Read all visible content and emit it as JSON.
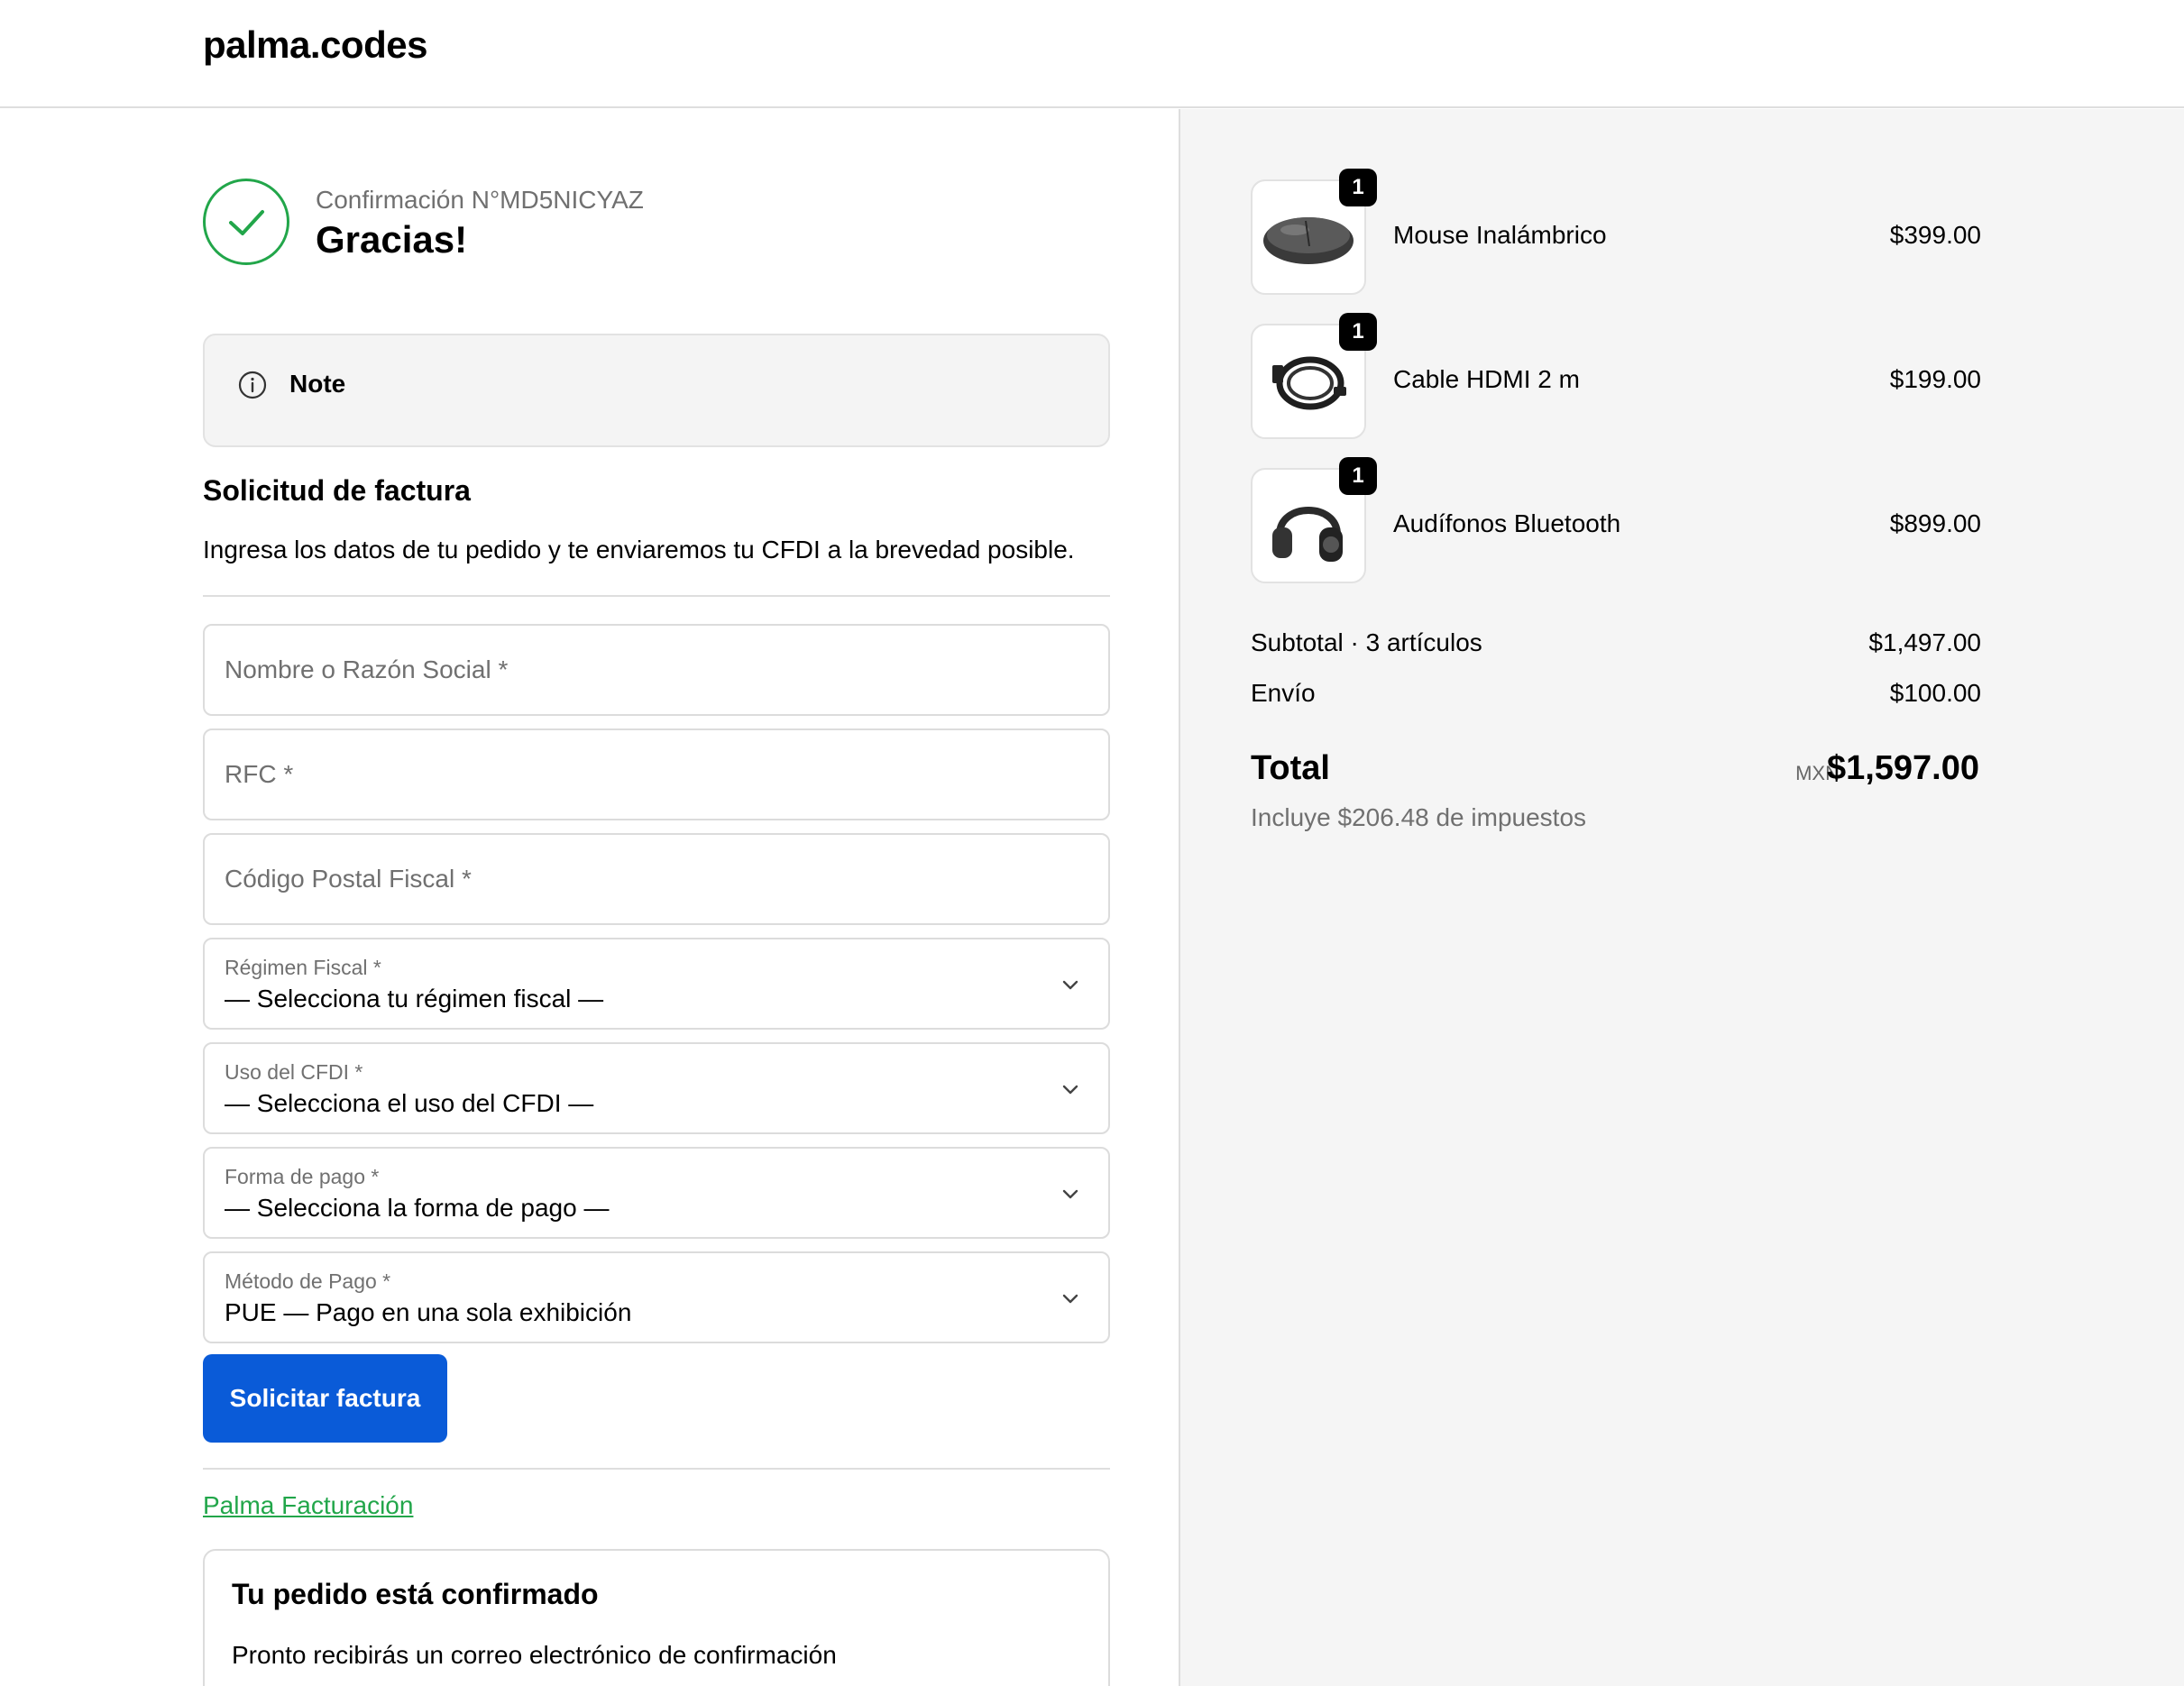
{
  "header": {
    "logo": "palma.codes"
  },
  "confirmation": {
    "number": "Confirmación N°MD5NICYAZ",
    "thanks": "Gracias!"
  },
  "note": {
    "icon": "info-icon",
    "label": "Note"
  },
  "invoice": {
    "title": "Solicitud de factura",
    "description": "Ingresa los datos de tu pedido y te enviaremos tu CFDI a la brevedad posible.",
    "fields": {
      "name_placeholder": "Nombre o Razón Social *",
      "rfc_placeholder": "RFC *",
      "zip_placeholder": "Código Postal Fiscal *"
    },
    "selects": {
      "regimen": {
        "label": "Régimen Fiscal *",
        "value": "— Selecciona tu régimen fiscal —"
      },
      "uso": {
        "label": "Uso del CFDI *",
        "value": "— Selecciona el uso del CFDI —"
      },
      "forma": {
        "label": "Forma de pago *",
        "value": "— Selecciona la forma de pago —"
      },
      "metodo": {
        "label": "Método de Pago *",
        "value": "PUE — Pago en una sola exhibición"
      }
    },
    "submit_label": "Solicitar factura",
    "footer_link": "Palma Facturación"
  },
  "order_confirmed": {
    "title": "Tu pedido está confirmado",
    "description": "Pronto recibirás un correo electrónico de confirmación"
  },
  "summary": {
    "items": [
      {
        "name": "Mouse Inalámbrico",
        "price": "$399.00",
        "qty": "1",
        "icon": "mouse-icon"
      },
      {
        "name": "Cable HDMI 2 m",
        "price": "$199.00",
        "qty": "1",
        "icon": "cable-icon"
      },
      {
        "name": "Audífonos Bluetooth",
        "price": "$899.00",
        "qty": "1",
        "icon": "headphones-icon"
      }
    ],
    "subtotal_label": "Subtotal · 3 artículos",
    "subtotal_value": "$1,497.00",
    "shipping_label": "Envío",
    "shipping_value": "$100.00",
    "total_label": "Total",
    "currency": "MXN",
    "total_value": "$1,597.00",
    "tax_note": "Incluye $206.48 de impuestos"
  },
  "colors": {
    "accent_blue": "#0a5bd8",
    "success_green": "#22a64a",
    "panel_bg": "#f5f5f5"
  }
}
